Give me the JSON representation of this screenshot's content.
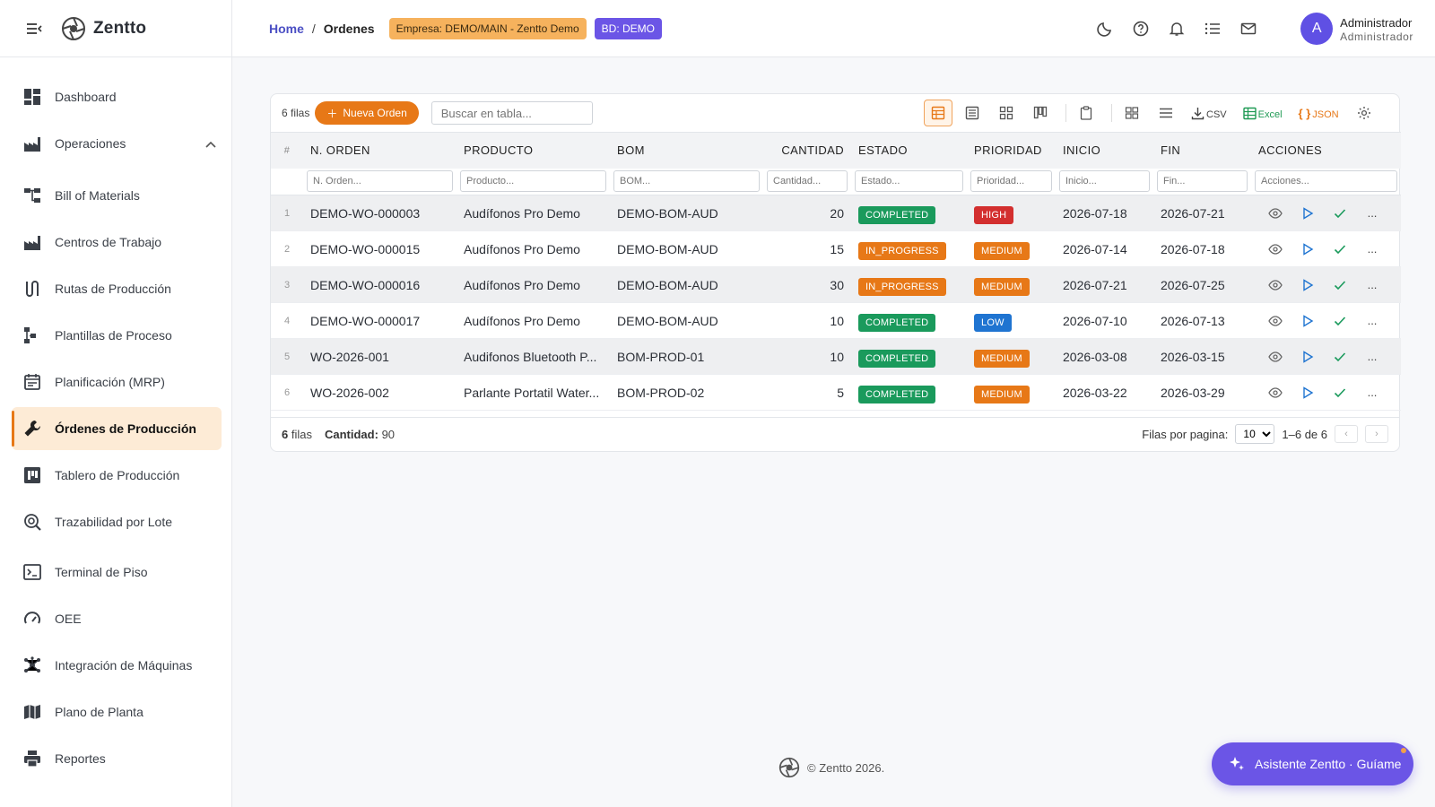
{
  "app": {
    "name": "Zentto"
  },
  "sidebar": {
    "items": [
      {
        "label": "Dashboard",
        "icon": "dashboard-icon"
      },
      {
        "label": "Operaciones",
        "icon": "factory-icon",
        "expanded": true
      },
      {
        "label": "Bill of Materials",
        "icon": "tree-icon"
      },
      {
        "label": "Centros de Trabajo",
        "icon": "factory-icon"
      },
      {
        "label": "Rutas de Producción",
        "icon": "route-icon"
      },
      {
        "label": "Plantillas de Proceso",
        "icon": "process-icon"
      },
      {
        "label": "Planificación (MRP)",
        "icon": "calendar-icon"
      },
      {
        "label": "Órdenes de Producción",
        "icon": "wrench-icon",
        "active": true
      },
      {
        "label": "Tablero de Producción",
        "icon": "board-icon"
      },
      {
        "label": "Trazabilidad por Lote",
        "icon": "trace-search-icon"
      },
      {
        "label": "Terminal de Piso",
        "icon": "terminal-icon"
      },
      {
        "label": "OEE",
        "icon": "gauge-icon"
      },
      {
        "label": "Integración de Máquinas",
        "icon": "hub-icon"
      },
      {
        "label": "Plano de Planta",
        "icon": "map-icon"
      },
      {
        "label": "Reportes",
        "icon": "printer-icon"
      }
    ]
  },
  "header": {
    "breadcrumb_home": "Home",
    "breadcrumb_sep": "/",
    "breadcrumb_current": "Ordenes",
    "company_chip": "Empresa: DEMO/MAIN - Zentto Demo",
    "db_chip": "BD: DEMO",
    "user": {
      "initial": "A",
      "name": "Administrador",
      "role": "Administrador"
    }
  },
  "toolbar": {
    "rows_label": "6 filas",
    "new_button": "Nueva Orden",
    "search_placeholder": "Buscar en tabla...",
    "csv_label": "CSV",
    "excel_label": "Excel",
    "json_label": "JSON"
  },
  "table": {
    "columns": [
      "#",
      "N. ORDEN",
      "PRODUCTO",
      "BOM",
      "CANTIDAD",
      "ESTADO",
      "PRIORIDAD",
      "INICIO",
      "FIN",
      "ACCIONES"
    ],
    "filters": [
      "N. Orden...",
      "Producto...",
      "BOM...",
      "Cantidad...",
      "Estado...",
      "Prioridad...",
      "Inicio...",
      "Fin...",
      "Acciones..."
    ],
    "rows": [
      {
        "idx": "1",
        "orden": "DEMO-WO-000003",
        "producto": "Audífonos Pro Demo",
        "bom": "DEMO-BOM-AUD",
        "cantidad": "20",
        "estado": "COMPLETED",
        "prioridad": "HIGH",
        "inicio": "2026-07-18",
        "fin": "2026-07-21"
      },
      {
        "idx": "2",
        "orden": "DEMO-WO-000015",
        "producto": "Audífonos Pro Demo",
        "bom": "DEMO-BOM-AUD",
        "cantidad": "15",
        "estado": "IN_PROGRESS",
        "prioridad": "MEDIUM",
        "inicio": "2026-07-14",
        "fin": "2026-07-18"
      },
      {
        "idx": "3",
        "orden": "DEMO-WO-000016",
        "producto": "Audífonos Pro Demo",
        "bom": "DEMO-BOM-AUD",
        "cantidad": "30",
        "estado": "IN_PROGRESS",
        "prioridad": "MEDIUM",
        "inicio": "2026-07-21",
        "fin": "2026-07-25"
      },
      {
        "idx": "4",
        "orden": "DEMO-WO-000017",
        "producto": "Audífonos Pro Demo",
        "bom": "DEMO-BOM-AUD",
        "cantidad": "10",
        "estado": "COMPLETED",
        "prioridad": "LOW",
        "inicio": "2026-07-10",
        "fin": "2026-07-13"
      },
      {
        "idx": "5",
        "orden": "WO-2026-001",
        "producto": "Audifonos Bluetooth P...",
        "bom": "BOM-PROD-01",
        "cantidad": "10",
        "estado": "COMPLETED",
        "prioridad": "MEDIUM",
        "inicio": "2026-03-08",
        "fin": "2026-03-15"
      },
      {
        "idx": "6",
        "orden": "WO-2026-002",
        "producto": "Parlante Portatil Water...",
        "bom": "BOM-PROD-02",
        "cantidad": "5",
        "estado": "COMPLETED",
        "prioridad": "MEDIUM",
        "inicio": "2026-03-22",
        "fin": "2026-03-29"
      }
    ],
    "more_label": "..."
  },
  "footer": {
    "rows_count": "6",
    "rows_word": "filas",
    "qty_label": "Cantidad:",
    "qty_value": "90",
    "per_page_label": "Filas por pagina:",
    "per_page_value": "10",
    "range": "1–6 de 6"
  },
  "page_footer": {
    "copyright": "© Zentto 2026."
  },
  "assistant": {
    "label": "Asistente Zentto · Guíame"
  },
  "colors": {
    "accent": "#e77817",
    "brand": "#6b55e6",
    "completed": "#1a9a5c",
    "high": "#d32f2f",
    "low": "#1f74d1"
  }
}
